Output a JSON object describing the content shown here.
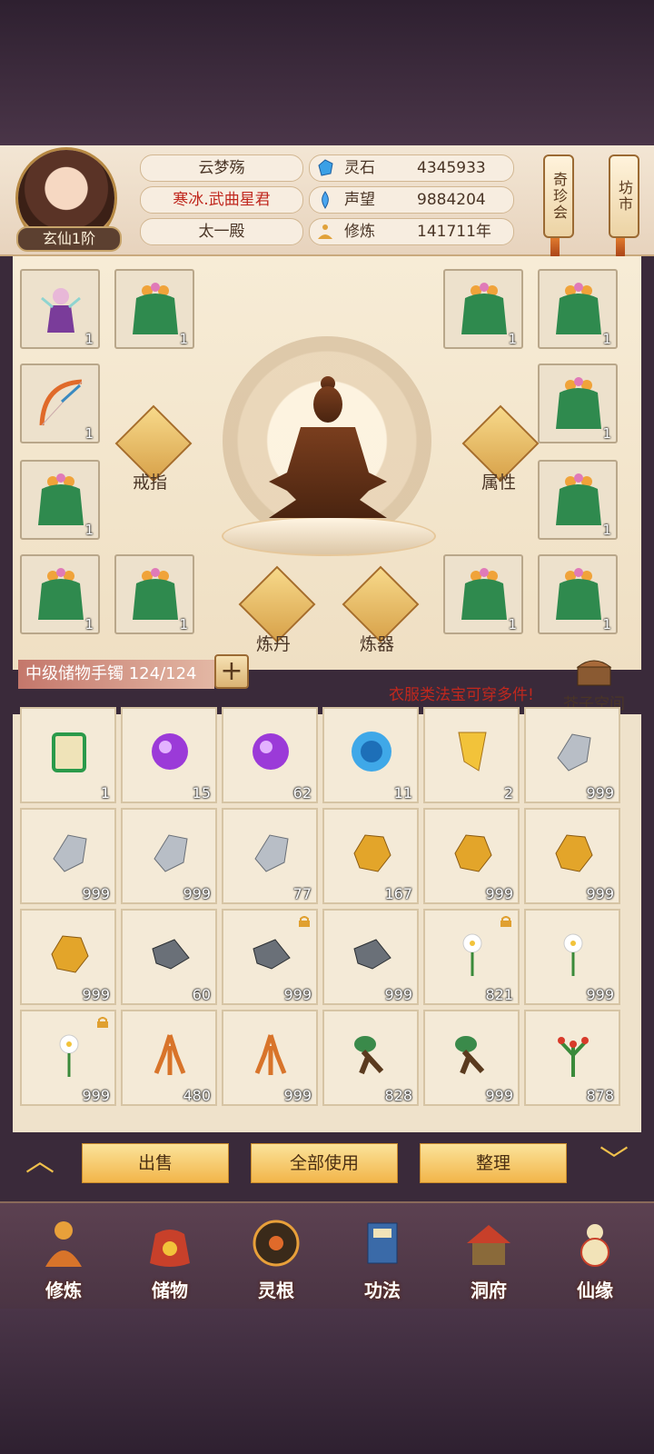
{
  "player": {
    "rank": "玄仙1阶",
    "name": "云梦殇",
    "title": "寒冰.武曲星君",
    "faction": "太一殿"
  },
  "stats": [
    {
      "label": "灵石",
      "value": "4345933",
      "icon": "spirit-stone-icon"
    },
    {
      "label": "声望",
      "value": "9884204",
      "icon": "reputation-icon"
    },
    {
      "label": "修炼",
      "value": "141711年",
      "icon": "meditation-icon"
    }
  ],
  "side_buttons": {
    "rare_shop": "奇珍会",
    "market": "坊市"
  },
  "equipment": {
    "center_actions": {
      "ring": "戒指",
      "attributes": "属性",
      "alchemy": "炼丹",
      "forge": "炼器"
    },
    "left_slots": [
      {
        "icon": "pet-fairy-icon",
        "qty": "1"
      },
      {
        "icon": "leaf-robe-icon",
        "qty": "1"
      },
      {
        "icon": "bow-icon",
        "qty": "1"
      },
      {
        "icon": "leaf-robe-icon",
        "qty": "1"
      },
      {
        "icon": "leaf-robe-icon",
        "qty": "1"
      },
      {
        "icon": "leaf-robe-icon",
        "qty": "1"
      }
    ],
    "right_slots": [
      {
        "icon": "leaf-robe-icon",
        "qty": "1"
      },
      {
        "icon": "leaf-robe-icon",
        "qty": "1"
      },
      {
        "icon": "leaf-robe-icon",
        "qty": "1"
      },
      {
        "icon": "leaf-robe-icon",
        "qty": "1"
      },
      {
        "icon": "leaf-robe-icon",
        "qty": "1"
      },
      {
        "icon": "leaf-robe-icon",
        "qty": "1"
      }
    ]
  },
  "storage": {
    "label": "中级储物手镯 124/124",
    "notice": "衣服类法宝可穿多件!",
    "mustard_space": "芥子空间"
  },
  "inventory": [
    {
      "icon": "scroll-icon",
      "qty": "1",
      "locked": false
    },
    {
      "icon": "purple-orb-icon",
      "qty": "15",
      "locked": false
    },
    {
      "icon": "purple-orb-icon",
      "qty": "62",
      "locked": false
    },
    {
      "icon": "blue-orb-icon",
      "qty": "11",
      "locked": false
    },
    {
      "icon": "golden-scroll-icon",
      "qty": "2",
      "locked": false
    },
    {
      "icon": "silver-ore-icon",
      "qty": "999",
      "locked": false
    },
    {
      "icon": "silver-ore-icon",
      "qty": "999",
      "locked": false
    },
    {
      "icon": "silver-ore-icon",
      "qty": "999",
      "locked": false
    },
    {
      "icon": "silver-ore-icon",
      "qty": "77",
      "locked": false
    },
    {
      "icon": "gold-ore-icon",
      "qty": "167",
      "locked": false
    },
    {
      "icon": "gold-ore-icon",
      "qty": "999",
      "locked": false
    },
    {
      "icon": "gold-ore-icon",
      "qty": "999",
      "locked": false
    },
    {
      "icon": "gold-ore-icon",
      "qty": "999",
      "locked": false
    },
    {
      "icon": "iron-ore-icon",
      "qty": "60",
      "locked": false
    },
    {
      "icon": "iron-ore-icon",
      "qty": "999",
      "locked": true
    },
    {
      "icon": "iron-ore-icon",
      "qty": "999",
      "locked": false
    },
    {
      "icon": "white-flower-icon",
      "qty": "821",
      "locked": true
    },
    {
      "icon": "white-flower-icon",
      "qty": "999",
      "locked": false
    },
    {
      "icon": "white-flower-icon",
      "qty": "999",
      "locked": true
    },
    {
      "icon": "ginseng-icon",
      "qty": "480",
      "locked": false
    },
    {
      "icon": "ginseng-icon",
      "qty": "999",
      "locked": false
    },
    {
      "icon": "herb-root-icon",
      "qty": "828",
      "locked": false
    },
    {
      "icon": "herb-root-icon",
      "qty": "999",
      "locked": false
    },
    {
      "icon": "red-berry-herb-icon",
      "qty": "878",
      "locked": false
    }
  ],
  "actions": {
    "sell": "出售",
    "use_all": "全部使用",
    "sort": "整理"
  },
  "nav": [
    {
      "label": "修炼",
      "icon": "cultivation-icon"
    },
    {
      "label": "储物",
      "icon": "storage-bag-icon"
    },
    {
      "label": "灵根",
      "icon": "spirit-root-icon"
    },
    {
      "label": "功法",
      "icon": "technique-book-icon"
    },
    {
      "label": "洞府",
      "icon": "cave-abode-icon"
    },
    {
      "label": "仙缘",
      "icon": "fate-gourd-icon"
    }
  ]
}
